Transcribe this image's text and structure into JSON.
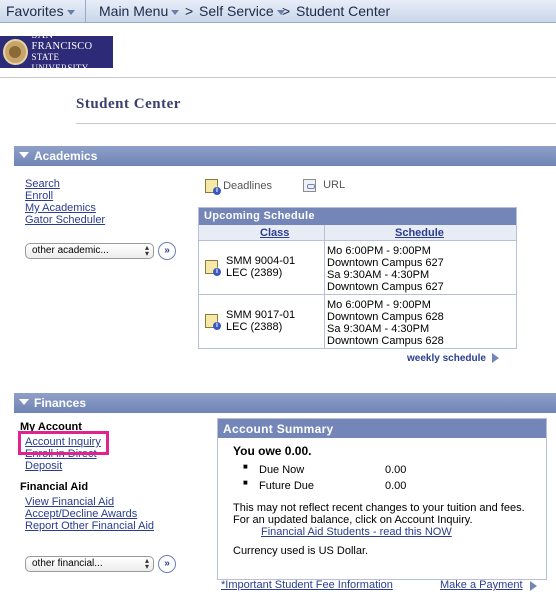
{
  "topnav": {
    "favorites": "Favorites",
    "main_menu": "Main Menu",
    "crumb_sep": ">",
    "self_service": "Self Service",
    "student_center": "Student Center"
  },
  "logo": {
    "line1": "San Francisco",
    "line2": "State University"
  },
  "page_title": "Student Center",
  "academics": {
    "title": "Academics",
    "links": [
      "Search",
      "Enroll",
      "My Academics",
      "Gator Scheduler"
    ],
    "select_value": "other academic...",
    "go_label": "»",
    "deadlines": "Deadlines",
    "url": "URL",
    "schedule": {
      "title": "Upcoming Schedule",
      "col_class": "Class",
      "col_schedule": "Schedule",
      "rows": [
        {
          "class1": "SMM 9004-01",
          "class2": "LEC (2389)",
          "sched": [
            "Mo 6:00PM - 9:00PM",
            "Downtown Campus 627",
            "Sa 9:30AM - 4:30PM",
            "Downtown Campus 627"
          ]
        },
        {
          "class1": "SMM 9017-01",
          "class2": "LEC (2388)",
          "sched": [
            "Mo 6:00PM - 9:00PM",
            "Downtown Campus 628",
            "Sa 9:30AM - 4:30PM",
            "Downtown Campus 628"
          ]
        }
      ],
      "weekly": "weekly schedule"
    }
  },
  "finances": {
    "title": "Finances",
    "my_account": "My Account",
    "account_links": [
      "Account Inquiry",
      "Enroll in Direct",
      "Deposit"
    ],
    "financial_aid": "Financial Aid",
    "aid_links": [
      "View Financial Aid",
      "Accept/Decline Awards",
      "Report Other Financial Aid"
    ],
    "select_value": "other financial...",
    "go_label": "»",
    "summary": {
      "title": "Account Summary",
      "owe": "You owe 0.00.",
      "due_now_label": "Due Now",
      "due_now_value": "0.00",
      "future_due_label": "Future Due",
      "future_due_value": "0.00",
      "note1": "This may not reflect recent changes to your tuition and fees.",
      "note2": "For an updated balance, click on Account Inquiry.",
      "aid_link": "Financial Aid Students - read this NOW",
      "currency": "Currency used is US Dollar."
    },
    "fee_info": "*Important Student Fee Information",
    "payment": "Make a Payment"
  },
  "colors": {
    "header_blue": "#7486b7",
    "link": "#2a3d8f",
    "highlight": "#e0238e",
    "logo_bg": "#2d2a78"
  }
}
